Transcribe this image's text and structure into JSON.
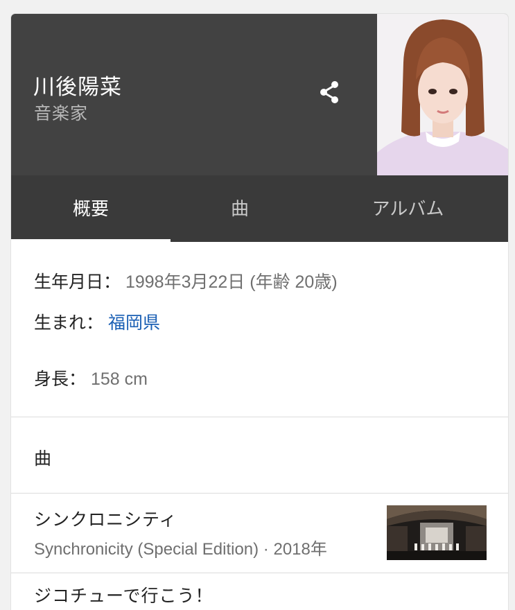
{
  "header": {
    "title": "川後陽菜",
    "subtitle": "音楽家",
    "share_icon": "share-icon",
    "photo_icon": "portrait-photo"
  },
  "tabs": [
    {
      "label": "概要",
      "active": true
    },
    {
      "label": "曲",
      "active": false
    },
    {
      "label": "アルバム",
      "active": false
    }
  ],
  "facts": {
    "birthdate": {
      "label": "生年月日：",
      "value": "1998年3月22日 (年齢 20歳)"
    },
    "birthplace": {
      "label": "生まれ：",
      "value": "福岡県"
    },
    "height": {
      "label": "身長：",
      "value": "158 cm"
    }
  },
  "songs_section": {
    "title": "曲",
    "items": [
      {
        "title": "シンクロニシティ",
        "subtitle": "Synchronicity (Special Edition) · 2018年",
        "thumbnail_icon": "video-thumbnail"
      },
      {
        "title": "ジコチューで行こう！"
      }
    ]
  },
  "colors": {
    "header_bg": "#424242",
    "tabs_bg": "#3a3a3a",
    "link": "#1a5fb4",
    "text_primary": "#222222",
    "text_secondary": "#6f6f6f"
  }
}
